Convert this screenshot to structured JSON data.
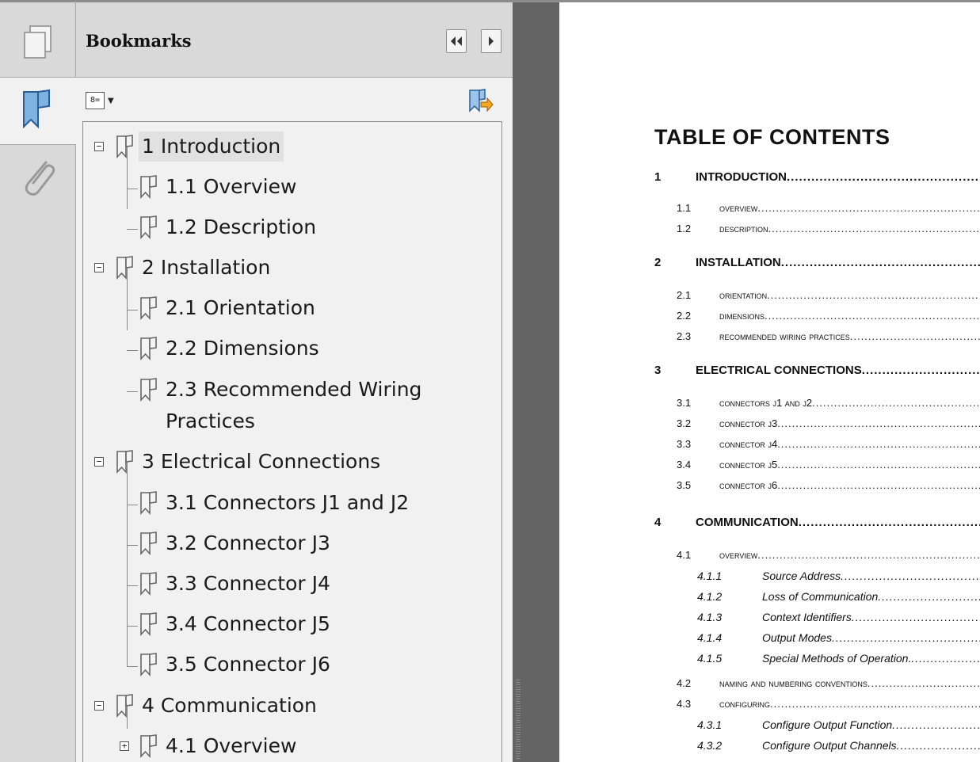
{
  "panel": {
    "title": "Bookmarks"
  },
  "icons": {
    "pages": "pages-icon",
    "bookmarks": "bookmark-ribbon-icon",
    "attachments": "paperclip-icon",
    "prev": "double-left-arrow-icon",
    "next": "right-arrow-icon",
    "options": "bookmark-options-icon",
    "goto": "goto-bookmark-icon"
  },
  "tree": [
    {
      "id": "b1",
      "label": "1 Introduction",
      "toggle": "⊟"
    },
    {
      "id": "b11",
      "label": "1.1 Overview"
    },
    {
      "id": "b12",
      "label": "1.2 Description"
    },
    {
      "id": "b2",
      "label": "2 Installation",
      "toggle": "⊟"
    },
    {
      "id": "b21",
      "label": "2.1 Orientation"
    },
    {
      "id": "b22",
      "label": "2.2 Dimensions"
    },
    {
      "id": "b23a",
      "label": "2.3 Recommended Wiring"
    },
    {
      "id": "b23b",
      "label": "Practices"
    },
    {
      "id": "b3",
      "label": "3 Electrical Connections",
      "toggle": "⊟"
    },
    {
      "id": "b31",
      "label": "3.1 Connectors J1 and J2"
    },
    {
      "id": "b32",
      "label": "3.2 Connector J3"
    },
    {
      "id": "b33",
      "label": "3.3 Connector J4"
    },
    {
      "id": "b34",
      "label": "3.4 Connector J5"
    },
    {
      "id": "b35",
      "label": "3.5 Connector J6"
    },
    {
      "id": "b4",
      "label": "4 Communication",
      "toggle": "⊟"
    },
    {
      "id": "b41",
      "label": "4.1 Overview",
      "toggle": "⊞"
    }
  ],
  "document": {
    "toc_title": "TABLE OF CONTENTS",
    "entries": [
      {
        "num": "1",
        "text": "INTRODUCTION"
      },
      {
        "num": "1.1",
        "text": "Overview"
      },
      {
        "num": "1.2",
        "text": "Description"
      },
      {
        "num": "2",
        "text": "INSTALLATION"
      },
      {
        "num": "2.1",
        "text": "Orientation"
      },
      {
        "num": "2.2",
        "text": "Dimensions"
      },
      {
        "num": "2.3",
        "text": "Recommended Wiring Practices"
      },
      {
        "num": "3",
        "text": "ELECTRICAL CONNECTIONS"
      },
      {
        "num": "3.1",
        "text": "Connectors J1 and J2"
      },
      {
        "num": "3.2",
        "text": "Connector J3"
      },
      {
        "num": "3.3",
        "text": "Connector J4"
      },
      {
        "num": "3.4",
        "text": "Connector J5"
      },
      {
        "num": "3.5",
        "text": "Connector J6"
      },
      {
        "num": "4",
        "text": "COMMUNICATION"
      },
      {
        "num": "4.1",
        "text": "Overview"
      },
      {
        "num": "4.1.1",
        "text": "Source Address"
      },
      {
        "num": "4.1.2",
        "text": "Loss of Communication"
      },
      {
        "num": "4.1.3",
        "text": "Context Identifiers"
      },
      {
        "num": "4.1.4",
        "text": "Output Modes"
      },
      {
        "num": "4.1.5",
        "text": "Special Methods of Operation."
      },
      {
        "num": "4.2",
        "text": "Naming and Numbering Conventions"
      },
      {
        "num": "4.3",
        "text": "Configuring"
      },
      {
        "num": "4.3.1",
        "text": "Configure Output Function"
      },
      {
        "num": "4.3.2",
        "text": "Configure Output Channels"
      }
    ]
  }
}
